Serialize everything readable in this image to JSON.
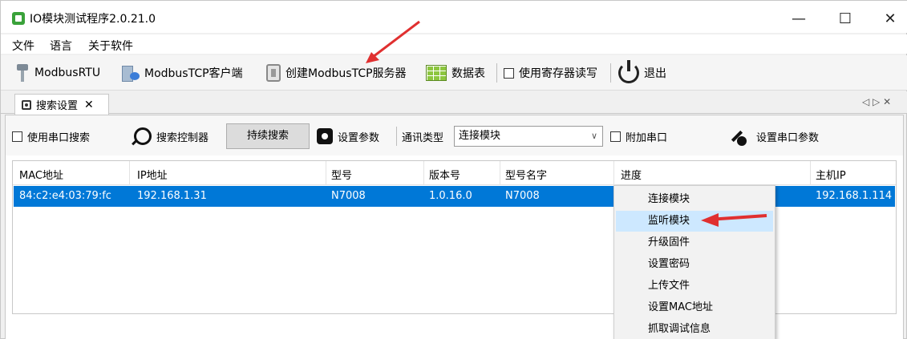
{
  "window": {
    "title": "IO模块测试程序2.0.21.0",
    "controls": {
      "minimize": "—",
      "maximize": "☐",
      "close": "✕"
    }
  },
  "menubar": {
    "items": [
      "文件",
      "语言",
      "关于软件"
    ]
  },
  "toolbar": {
    "modbus_rtu": "ModbusRTU",
    "modbus_tcp_client": "ModbusTCP客户端",
    "create_tcp_server": "创建ModbusTCP服务器",
    "data_table": "数据表",
    "use_register_rw": "使用寄存器读写",
    "exit": "退出"
  },
  "tab": {
    "label": "搜索设置",
    "close": "✕",
    "arrows": "◁ ▷ ✕"
  },
  "controls": {
    "use_serial_search": "使用串口搜索",
    "search_controller": "搜索控制器",
    "continuous_search": "持续搜索",
    "set_params": "设置参数",
    "comm_type_label": "通讯类型",
    "comm_type_value": "连接模块",
    "attach_serial": "附加串口",
    "set_serial_params": "设置串口参数"
  },
  "table": {
    "columns": [
      "MAC地址",
      "IP地址",
      "型号",
      "版本号",
      "型号名字",
      "进度",
      "主机IP"
    ],
    "rows": [
      [
        "84:c2:e4:03:79:fc",
        "192.168.1.31",
        "N7008",
        "1.0.16.0",
        "N7008",
        "",
        "192.168.1.114"
      ]
    ],
    "selected_row": 0
  },
  "context_menu": {
    "items": [
      "连接模块",
      "监听模块",
      "升级固件",
      "设置密码",
      "上传文件",
      "设置MAC地址",
      "抓取调试信息"
    ],
    "highlighted": 1
  },
  "colors": {
    "selection": "#0078d7",
    "menu_highlight": "#cde8ff",
    "annotation": "#e03030"
  }
}
